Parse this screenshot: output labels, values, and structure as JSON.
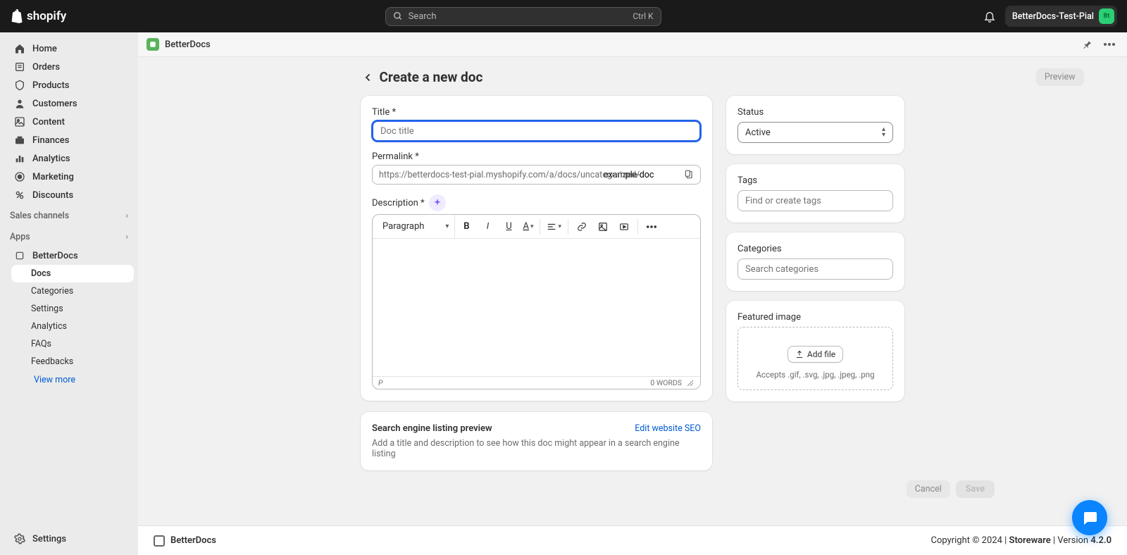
{
  "topbar": {
    "brand": "shopify",
    "search_placeholder": "Search",
    "search_shortcut": "Ctrl K",
    "store_name": "BetterDocs-Test-Pial",
    "avatar_initials": "Bt"
  },
  "sidebar": {
    "main": [
      {
        "label": "Home"
      },
      {
        "label": "Orders"
      },
      {
        "label": "Products"
      },
      {
        "label": "Customers"
      },
      {
        "label": "Content"
      },
      {
        "label": "Finances"
      },
      {
        "label": "Analytics"
      },
      {
        "label": "Marketing"
      },
      {
        "label": "Discounts"
      }
    ],
    "sales_channels_label": "Sales channels",
    "apps_label": "Apps",
    "apps": {
      "app_name": "BetterDocs",
      "items": [
        {
          "label": "Docs",
          "active": true
        },
        {
          "label": "Categories"
        },
        {
          "label": "Settings"
        },
        {
          "label": "Analytics"
        },
        {
          "label": "FAQs"
        },
        {
          "label": "Feedbacks"
        }
      ],
      "view_more": "View more"
    },
    "settings_label": "Settings"
  },
  "app_header": {
    "app_name": "BetterDocs"
  },
  "page": {
    "title": "Create a new doc",
    "preview_btn": "Preview",
    "title_field": {
      "label": "Title",
      "placeholder": "Doc title",
      "value": ""
    },
    "permalink_field": {
      "label": "Permalink",
      "prefix": "https://betterdocs-test-pial.myshopify.com/a/docs/uncategorized/",
      "value": "example-doc"
    },
    "description_field": {
      "label": "Description",
      "format_label": "Paragraph",
      "word_count": "0 WORDS",
      "p_indicator": "P"
    },
    "seo": {
      "title": "Search engine listing preview",
      "link": "Edit website SEO",
      "desc": "Add a title and description to see how this doc might appear in a search engine listing"
    },
    "status": {
      "label": "Status",
      "selected": "Active"
    },
    "tags": {
      "label": "Tags",
      "placeholder": "Find or create tags"
    },
    "categories": {
      "label": "Categories",
      "placeholder": "Search categories"
    },
    "featured": {
      "label": "Featured image",
      "add_btn": "Add file",
      "accepts": "Accepts .gif, .svg, .jpg, .jpeg, .png"
    },
    "cancel_btn": "Cancel",
    "save_btn": "Save"
  },
  "footer": {
    "brand": "BetterDocs",
    "copyright": "Copyright © 2024 | ",
    "storeware": "Storeware",
    "version_pre": " | Version ",
    "version": "4.2.0"
  }
}
